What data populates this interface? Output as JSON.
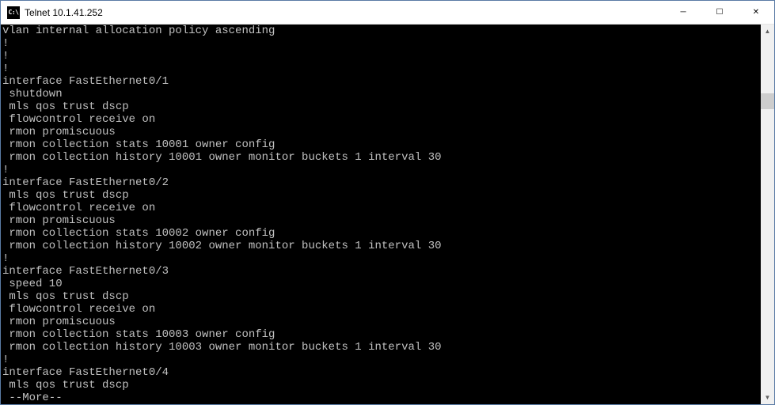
{
  "titlebar": {
    "icon_text": "C:\\",
    "title": "Telnet 10.1.41.252",
    "minimize": "─",
    "maximize": "☐",
    "close": "✕"
  },
  "scrollbar": {
    "up": "▲",
    "down": "▼"
  },
  "terminal": {
    "lines": [
      "vlan internal allocation policy ascending",
      "!",
      "!",
      "!",
      "interface FastEthernet0/1",
      " shutdown",
      " mls qos trust dscp",
      " flowcontrol receive on",
      " rmon promiscuous",
      " rmon collection stats 10001 owner config",
      " rmon collection history 10001 owner monitor buckets 1 interval 30",
      "!",
      "interface FastEthernet0/2",
      " mls qos trust dscp",
      " flowcontrol receive on",
      " rmon promiscuous",
      " rmon collection stats 10002 owner config",
      " rmon collection history 10002 owner monitor buckets 1 interval 30",
      "!",
      "interface FastEthernet0/3",
      " speed 10",
      " mls qos trust dscp",
      " flowcontrol receive on",
      " rmon promiscuous",
      " rmon collection stats 10003 owner config",
      " rmon collection history 10003 owner monitor buckets 1 interval 30",
      "!",
      "interface FastEthernet0/4",
      " mls qos trust dscp",
      " --More--"
    ]
  }
}
